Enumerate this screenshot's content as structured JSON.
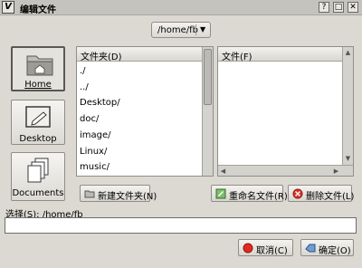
{
  "title": "编辑文件",
  "titlebar_buttons": [
    "?",
    "□",
    "✕"
  ],
  "path_button": {
    "label": "/home/fb"
  },
  "places": [
    {
      "label": "Home",
      "icon": "home-folder-icon"
    },
    {
      "label": "Desktop",
      "icon": "desktop-folder-icon"
    },
    {
      "label": "Documents",
      "icon": "documents-icon"
    }
  ],
  "folders": {
    "header": "文件夹(D)",
    "items": [
      "./",
      "../",
      "Desktop/",
      "doc/",
      "image/",
      "Linux/",
      "music/"
    ]
  },
  "files": {
    "header": "文件(F)",
    "items": []
  },
  "buttons": {
    "new_folder": "新建文件夹(N)",
    "rename": "重命名文件(R)",
    "delete": "删除文件(L)",
    "cancel": "取消(C)",
    "ok": "确定(O)"
  },
  "selection": {
    "label": "选择(S): /home/fb",
    "value": ""
  }
}
